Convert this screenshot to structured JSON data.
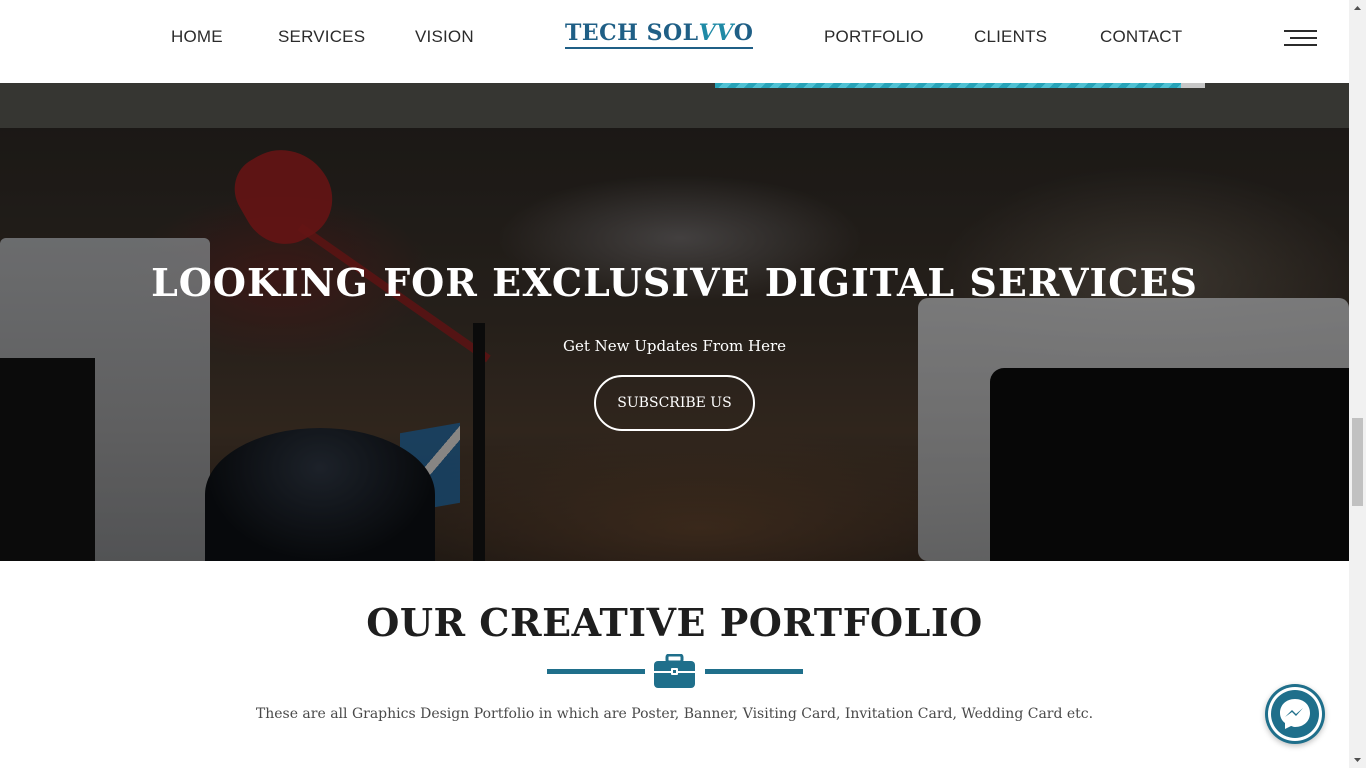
{
  "nav": {
    "left_items": [
      "HOME",
      "SERVICES",
      "VISION"
    ],
    "right_items": [
      "PORTFOLIO",
      "CLIENTS",
      "CONTACT"
    ],
    "logo_text_main": "TECH SOL",
    "logo_text_vv": "VV",
    "logo_text_end": "O",
    "menu_icon": "hamburger-menu-icon"
  },
  "progress": {
    "fill_fraction": 0.95,
    "color": "#27a3b8"
  },
  "hero": {
    "title": "LOOKING FOR EXCLUSIVE DIGITAL SERVICES",
    "subtitle": "Get New Updates From Here",
    "button_label": "SUBSCRIBE US"
  },
  "portfolio": {
    "title": "OUR CREATIVE PORTFOLIO",
    "icon": "briefcase-icon",
    "description": "These are all Graphics Design Portfolio in which are Poster, Banner, Visiting Card, Invitation Card, Wedding Card etc."
  },
  "messenger": {
    "icon": "messenger-icon"
  },
  "colors": {
    "accent": "#1f6f8b",
    "nav_text": "#2b2b2b",
    "dark_strip": "#363632"
  }
}
